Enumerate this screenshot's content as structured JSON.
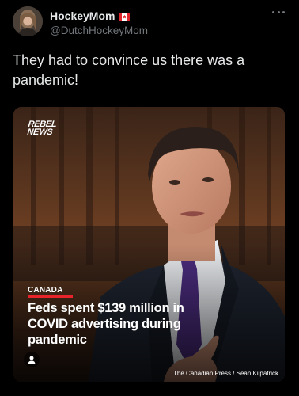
{
  "tweet": {
    "author": {
      "display_name": "HockeyMom",
      "handle": "@DutchHockeyMom",
      "flag": "canada-flag-icon"
    },
    "text": "They had to convince us there was a pandemic!",
    "more_icon": "more-options-icon"
  },
  "media": {
    "logo_line1": "REBEL",
    "logo_line2": "NEWS",
    "category": "CANADA",
    "headline": "Feds spent $139 million in COVID advertising during pandemic",
    "person_icon": "person-tag-icon",
    "credit": "The Canadian Press / Sean Kilpatrick"
  },
  "colors": {
    "background": "#000000",
    "primary_text": "#e7e9ea",
    "secondary_text": "#71767b",
    "accent_red": "#e6242a",
    "tie_purple": "#4b2c7e"
  }
}
